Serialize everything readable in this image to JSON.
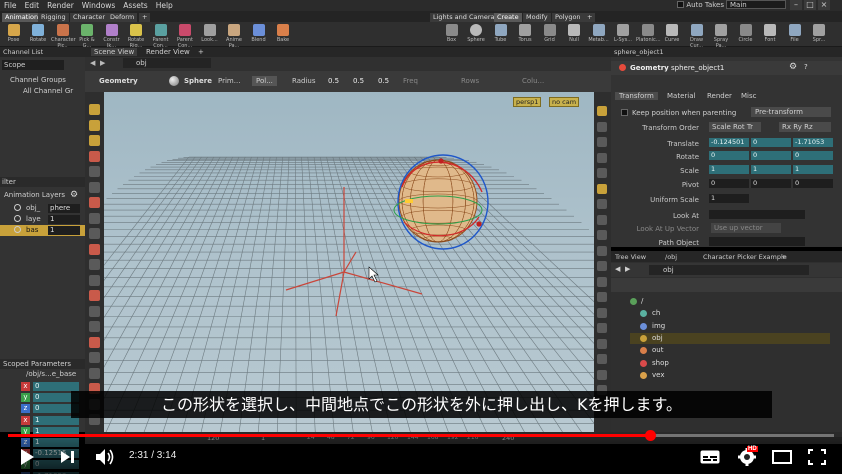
{
  "menubar": {
    "items": [
      "File",
      "Edit",
      "Render",
      "Windows",
      "Assets",
      "Help"
    ],
    "auto_takes": "Auto Takes",
    "desktop": "Main"
  },
  "shelf_tabs_left": [
    "Animation",
    "Rigging",
    "Character",
    "Deform",
    "+"
  ],
  "shelf_tabs_right": [
    "Lights and Cameras",
    "Create",
    "Modify",
    "Polygon",
    "+"
  ],
  "shelf_tools_left": [
    "Pose",
    "Rotate",
    "Character Pic..",
    "Pick & G...",
    "Constr Ik...",
    "Rotate Rig...",
    "Parent Con...",
    "Parent Con...",
    "Look...",
    "Anime Pa...",
    "Blend",
    "Bake"
  ],
  "shelf_tools_right": [
    "Box",
    "Sphere",
    "Tube",
    "Torus",
    "Grid",
    "Null",
    "Metab...",
    "L-Sys...",
    "Platonic...",
    "Curve",
    "Draw Cur...",
    "Spray Pa...",
    "Circle",
    "Font",
    "File",
    "Spr..."
  ],
  "left_panel": {
    "tab": "Channel List",
    "scope": "Scope",
    "channel_groups": "Channel Groups",
    "all_channels": "All Channel Gr",
    "filter": "ilter",
    "animation_layers": "Animation Layers",
    "layers": [
      {
        "name": "obj_",
        "value": "phere"
      },
      {
        "name": "laye",
        "value": "1"
      },
      {
        "name": "bas",
        "value": "1"
      }
    ],
    "scoped_parameters": "Scoped Parameters",
    "scoped_path": "/obj/s...e_base",
    "params": [
      {
        "axis": "x",
        "value": "0"
      },
      {
        "axis": "y",
        "value": "0"
      },
      {
        "axis": "z",
        "value": "0"
      },
      {
        "axis": "x",
        "value": "1"
      },
      {
        "axis": "y",
        "value": "1"
      },
      {
        "axis": "z",
        "value": "1"
      },
      {
        "axis": "x",
        "value": "-0.12515"
      },
      {
        "axis": "y",
        "value": "0"
      },
      {
        "axis": "z",
        "value": "-1.71053"
      }
    ]
  },
  "center_tabs": [
    "Scene View",
    "Render View",
    "+"
  ],
  "center_path": "obj",
  "viewport_toolbar": {
    "context": "Geometry",
    "object": "Sphere",
    "prim_label": "Prim...",
    "primitive_type": "Pol...",
    "radius_label": "Radius",
    "radius": [
      "0.5",
      "0.5",
      "0.5"
    ],
    "freq_label": "Freq",
    "rows_label": "Rows",
    "cols_label": "Colu..."
  },
  "camera_menu": "persp1",
  "camera_mode": "no cam",
  "right_top": {
    "tab": "sphere_object1",
    "context": "Geometry",
    "node_name": "sphere_object1",
    "subtabs": [
      "Transform",
      "Material",
      "Render",
      "Misc"
    ],
    "keep_position": "Keep position when parenting",
    "pre_transform": "Pre-transform",
    "transform_order_label": "Transform Order",
    "transform_order": "Scale Rot Tr",
    "rotate_order": "Rx Ry Rz",
    "translate_label": "Translate",
    "translate": [
      "-0.124501",
      "0",
      "-1.71053"
    ],
    "rotate_label": "Rotate",
    "rotate": [
      "0",
      "0",
      "0"
    ],
    "scale_label": "Scale",
    "scale": [
      "1",
      "1",
      "1"
    ],
    "pivot_label": "Pivot",
    "pivot": [
      "0",
      "0",
      "0"
    ],
    "uniform_scale_label": "Uniform Scale",
    "uniform_scale": "1",
    "look_at_label": "Look At",
    "look_at_up_label": "Look At Up Vector",
    "look_at_up": "Use up vector",
    "path_object_label": "Path Object"
  },
  "right_bottom": {
    "tabs": [
      "Tree View",
      "/obj",
      "Character Picker Example",
      "+"
    ],
    "path": "obj",
    "tree": [
      "/",
      "ch",
      "img",
      "obj",
      "out",
      "shop",
      "vex"
    ]
  },
  "timeline": {
    "start": "1",
    "frame": "1",
    "current": "120",
    "ticks": [
      "24",
      "48",
      "72",
      "96",
      "120",
      "144",
      "168",
      "192",
      "216"
    ],
    "end": "240"
  },
  "subtitle": "この形状を選択し、中間地点でこの形状を外に押し出し、Kを押します。",
  "player": {
    "time": "2:31 / 3:14",
    "progress": 0.778,
    "hd": "HD"
  }
}
